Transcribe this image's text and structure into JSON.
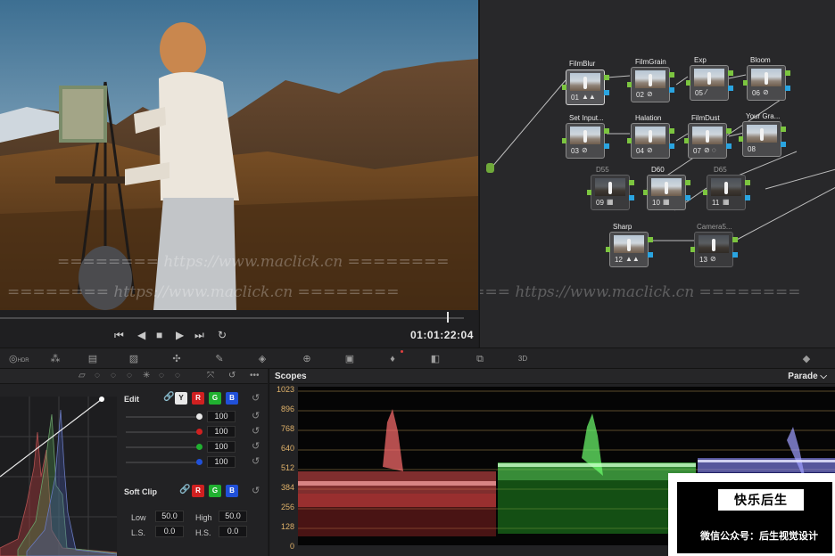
{
  "viewer": {
    "timecode": "01:01:22:04",
    "transport": {
      "prev": "⏮",
      "back": "◀",
      "stop": "■",
      "play": "▶",
      "next": "⏭",
      "loop": "↻"
    }
  },
  "watermark": {
    "line1": "======== https://www.maclick.cn ========",
    "line2": "======== https://www.maclick.cn ========"
  },
  "nodes": [
    {
      "label": "FilmBlur",
      "num": "01",
      "icon": "▲▲",
      "selected": true
    },
    {
      "label": "FilmGrain",
      "num": "02",
      "icon": "⊘"
    },
    {
      "label": "Exp",
      "num": "05",
      "icon": "⁄"
    },
    {
      "label": "Bloom",
      "num": "06",
      "icon": "⊘"
    },
    {
      "label": "Set Input...",
      "num": "03",
      "icon": "⊘"
    },
    {
      "label": "Halation",
      "num": "04",
      "icon": "⊘"
    },
    {
      "label": "FilmDust",
      "num": "07",
      "icon": "⊘ ◌"
    },
    {
      "label": "Your Gra...",
      "num": "08",
      "icon": ""
    },
    {
      "label": "D55",
      "num": "09",
      "icon": "▦",
      "dim": true
    },
    {
      "label": "D60",
      "num": "10",
      "icon": "▦"
    },
    {
      "label": "D65",
      "num": "11",
      "icon": "▦",
      "dim": true
    },
    {
      "label": "Sharp",
      "num": "12",
      "icon": "▲▲"
    },
    {
      "label": "Camera5...",
      "num": "13",
      "icon": "⊘",
      "dim": true
    }
  ],
  "curves": {
    "edit_label": "Edit",
    "channels": {
      "y": "Y",
      "r": "R",
      "g": "G",
      "b": "B"
    },
    "intensities": [
      "100",
      "100",
      "100",
      "100"
    ],
    "soft_clip_label": "Soft Clip",
    "low_label": "Low",
    "low_value": "50.0",
    "high_label": "High",
    "high_value": "50.0",
    "ls_label": "L.S.",
    "ls_value": "0.0",
    "hs_label": "H.S.",
    "hs_value": "0.0",
    "more": "•••"
  },
  "scopes": {
    "title": "Scopes",
    "mode": "Parade ⌵",
    "ticks": [
      "1023",
      "896",
      "768",
      "640",
      "512",
      "384",
      "256",
      "128",
      "0"
    ]
  },
  "badge": {
    "title": "快乐后生",
    "subtitle": "微信公众号：后生视觉设计"
  },
  "toolbar": {
    "hdr": "HDR",
    "three_d": "3D"
  },
  "colors": {
    "accent_green": "#7cc540",
    "accent_blue": "#2aa4e0",
    "scope_tick": "#e0b26a"
  }
}
